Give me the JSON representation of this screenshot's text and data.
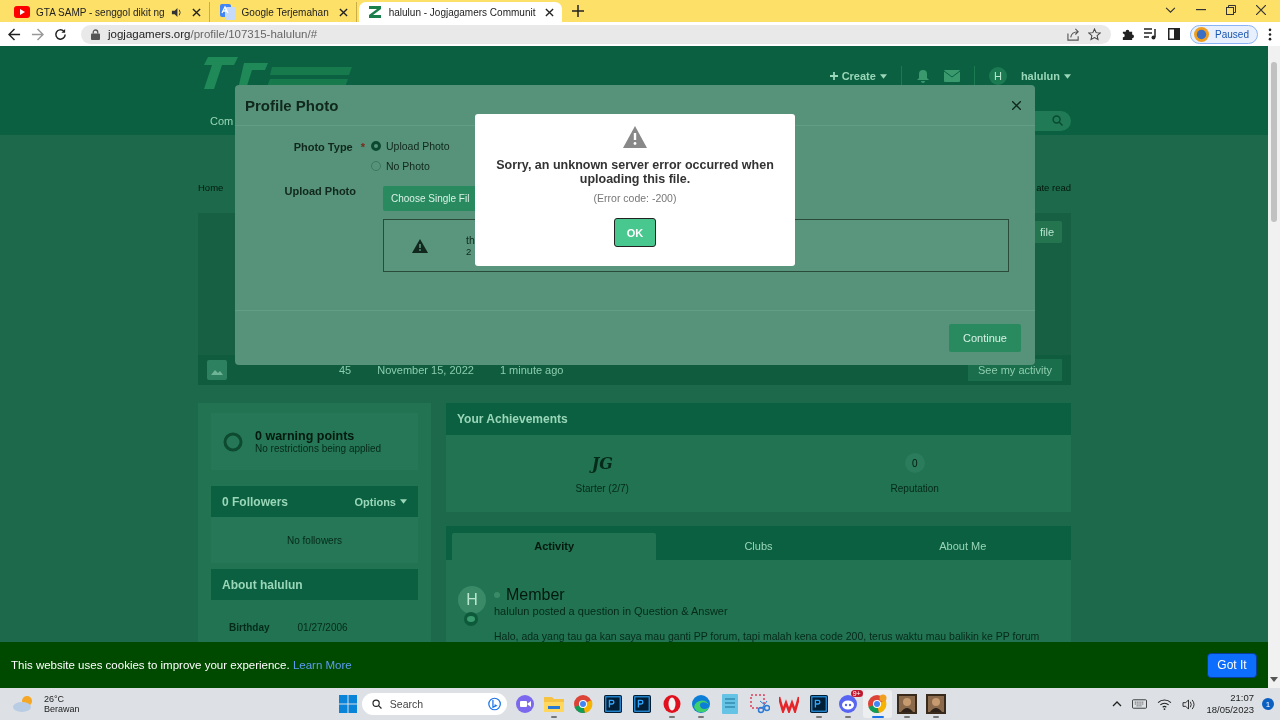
{
  "browser": {
    "tabs": [
      {
        "title": "GTA SAMP - senggol dikit ng",
        "kind": "youtube",
        "audio": true,
        "selected": false
      },
      {
        "title": "Google Terjemahan",
        "kind": "translate",
        "audio": false,
        "selected": false
      },
      {
        "title": "halulun - Jogjagamers Communit",
        "kind": "site",
        "audio": false,
        "selected": true
      }
    ],
    "url": {
      "domain": "jogjagamers.org",
      "path": "/profile/107315-halulun/#"
    },
    "profile_chip": "Paused"
  },
  "site": {
    "header": {
      "create": "Create",
      "user_initial": "H",
      "username": "halulun",
      "nav_item": "Com"
    },
    "breadcrumb": "Home",
    "mark_read": "ate read",
    "cover_button": "file",
    "profile_bar": {
      "stats": [
        "45",
        "November 15, 2022",
        "1 minute ago"
      ],
      "activity_button": "See my activity"
    },
    "warning": {
      "title": "0 warning points",
      "subtitle": "No restrictions being applied"
    },
    "followers": {
      "title": "0 Followers",
      "options": "Options",
      "empty": "No followers"
    },
    "about": {
      "title": "About halulun",
      "fields": [
        {
          "label": "Birthday",
          "value": "01/27/2006"
        }
      ]
    },
    "achievements": {
      "title": "Your Achievements",
      "items": [
        {
          "kind": "badge",
          "value": "JG",
          "label": "Starter (2/7)"
        },
        {
          "kind": "count",
          "value": "0",
          "label": "Reputation"
        }
      ]
    },
    "tabs": [
      {
        "label": "Activity",
        "selected": true
      },
      {
        "label": "Clubs",
        "selected": false
      },
      {
        "label": "About Me",
        "selected": false
      }
    ],
    "activity": {
      "avatar": "H",
      "rank": "Member",
      "summary": "halulun posted a question in Question & Answer",
      "excerpt": "Halo, ada yang tau ga kan saya mau ganti PP forum, tapi malah kena code 200, terus waktu mau balikin ke PP forum"
    }
  },
  "profile_photo_dialog": {
    "title": "Profile Photo",
    "photo_type_label": "Photo Type",
    "required_mark": "*",
    "options": [
      {
        "label": "Upload Photo",
        "selected": true
      },
      {
        "label": "No Photo",
        "selected": false
      }
    ],
    "upload_label": "Upload Photo",
    "choose_button": "Choose Single Fil",
    "file": {
      "name": "th",
      "info": "2"
    },
    "continue_button": "Continue"
  },
  "error_dialog": {
    "message": "Sorry, an unknown server error occurred when uploading this file.",
    "code": "(Error code: -200)",
    "ok_button": "OK"
  },
  "cookie_bar": {
    "text": "This website uses cookies to improve your experience.",
    "link": "Learn More",
    "button": "Got It"
  },
  "taskbar": {
    "weather": {
      "temp": "26°C",
      "condition": "Berawan"
    },
    "search_placeholder": "Search",
    "apps": [
      {
        "kind": "meet",
        "running": false,
        "selected": false
      },
      {
        "kind": "folder",
        "running": true,
        "selected": false
      },
      {
        "kind": "chrome",
        "running": false,
        "selected": false
      },
      {
        "kind": "photoshop",
        "running": false,
        "selected": false
      },
      {
        "kind": "photoshop",
        "running": false,
        "selected": false
      },
      {
        "kind": "opera",
        "running": true,
        "selected": false
      },
      {
        "kind": "edge",
        "running": true,
        "selected": false
      },
      {
        "kind": "notepad",
        "running": false,
        "selected": false
      },
      {
        "kind": "snip",
        "running": false,
        "selected": false
      },
      {
        "kind": "wps",
        "running": false,
        "selected": false
      },
      {
        "kind": "photoshop",
        "running": true,
        "selected": false
      },
      {
        "kind": "discord",
        "running": true,
        "selected": false,
        "badge": "9+"
      },
      {
        "kind": "chrome",
        "running": true,
        "selected": true
      },
      {
        "kind": "game",
        "running": true,
        "selected": false
      },
      {
        "kind": "game",
        "running": true,
        "selected": false
      }
    ],
    "time": "21:07",
    "date": "18/05/2023",
    "notifications": "1"
  }
}
